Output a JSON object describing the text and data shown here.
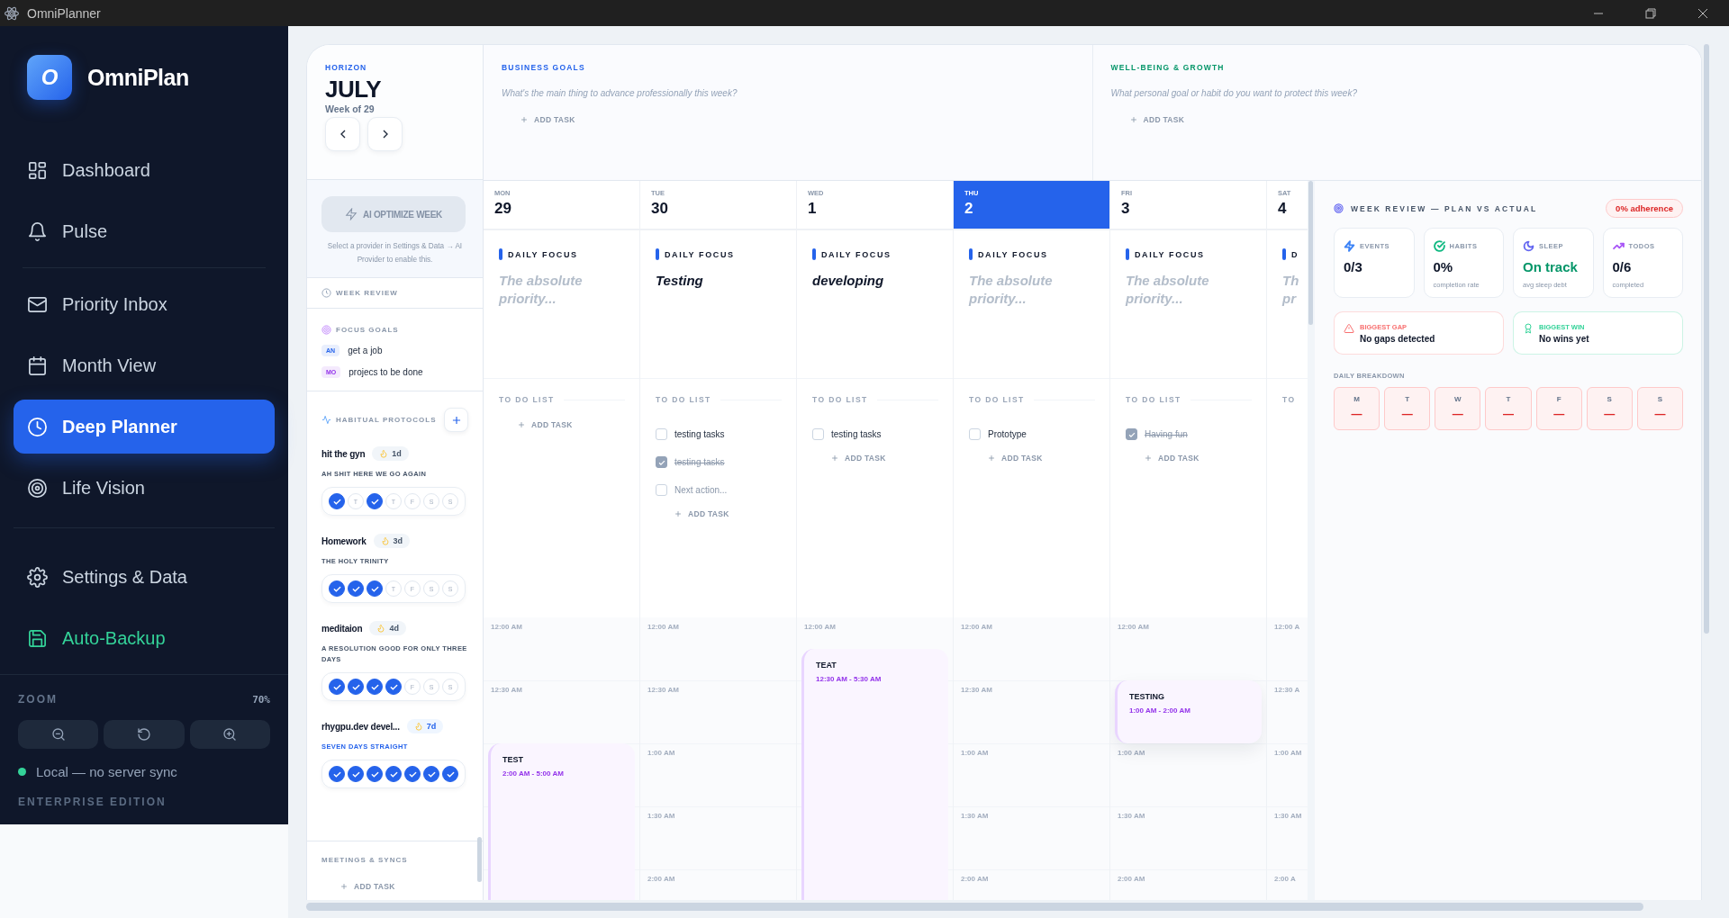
{
  "titlebar": {
    "title": "OmniPlanner"
  },
  "sidebar": {
    "brand": {
      "logo": "O",
      "name": "OmniPlan"
    },
    "groups": [
      {
        "items": [
          {
            "label": "Dashboard",
            "selected": false,
            "kind": "page"
          },
          {
            "label": "Pulse",
            "selected": false,
            "kind": "page"
          }
        ]
      },
      {
        "items": [
          {
            "label": "Priority Inbox",
            "selected": false,
            "kind": "page"
          },
          {
            "label": "Month View",
            "selected": false,
            "kind": "page"
          },
          {
            "label": "Deep Planner",
            "selected": true,
            "kind": "page"
          },
          {
            "label": "Life Vision",
            "selected": false,
            "kind": "page"
          }
        ]
      },
      {
        "items": [
          {
            "label": "Settings & Data",
            "selected": false,
            "kind": "page"
          },
          {
            "label": "Auto-Backup",
            "selected": false,
            "kind": "backup"
          }
        ]
      }
    ],
    "zoom": {
      "label": "ZOOM",
      "value": "70%"
    },
    "status": {
      "text": "Local — no server sync",
      "color": "#34d399"
    },
    "edition": "ENTERPRISE EDITION"
  },
  "horizon": {
    "label": "HORIZON",
    "month": "JULY",
    "week": "Week of 29"
  },
  "ai": {
    "button": "AI OPTIMIZE WEEK",
    "disabled": true,
    "hint": "Select a provider in Settings & Data → AI Provider to enable this."
  },
  "week_review_link": "WEEK REVIEW",
  "focus_goals": {
    "title": "FOCUS GOALS",
    "items": [
      {
        "tag": "AN",
        "text": "get a job",
        "color": "#2563eb"
      },
      {
        "tag": "MO",
        "text": "projecs to be done",
        "color": "#9333ea"
      }
    ]
  },
  "habits": {
    "title": "HABITUAL PROTOCOLS",
    "items": [
      {
        "name": "hit the gyn",
        "streak": "1d",
        "motto": "AH SHIT HERE WE GO AGAIN",
        "perfect": false,
        "days": [
          {
            "checked": true
          },
          {
            "label": "T",
            "checked": false
          },
          {
            "checked": true
          },
          {
            "label": "T",
            "checked": false
          },
          {
            "label": "F",
            "checked": false
          },
          {
            "label": "S",
            "checked": false
          },
          {
            "label": "S",
            "checked": false
          }
        ]
      },
      {
        "name": "Homework",
        "streak": "3d",
        "motto": "THE HOLY TRINITY",
        "perfect": false,
        "days": [
          {
            "checked": true
          },
          {
            "checked": true
          },
          {
            "checked": true
          },
          {
            "label": "T",
            "checked": false
          },
          {
            "label": "F",
            "checked": false
          },
          {
            "label": "S",
            "checked": false
          },
          {
            "label": "S",
            "checked": false
          }
        ]
      },
      {
        "name": "meditaion",
        "streak": "4d",
        "motto": "A RESOLUTION GOOD FOR ONLY THREE DAYS",
        "perfect": false,
        "days": [
          {
            "checked": true
          },
          {
            "checked": true
          },
          {
            "checked": true
          },
          {
            "checked": true
          },
          {
            "label": "F",
            "checked": false
          },
          {
            "label": "S",
            "checked": false
          },
          {
            "label": "S",
            "checked": false
          }
        ]
      },
      {
        "name": "rhygpu.dev devel...",
        "streak": "7d",
        "motto": "SEVEN DAYS STRAIGHT",
        "perfect": true,
        "days": [
          {
            "checked": true
          },
          {
            "checked": true
          },
          {
            "checked": true
          },
          {
            "checked": true
          },
          {
            "checked": true
          },
          {
            "checked": true
          },
          {
            "checked": true
          }
        ]
      }
    ]
  },
  "meetings": {
    "title": "MEETINGS & SYNCS",
    "add": "ADD TASK"
  },
  "goals": [
    {
      "title": "BUSINESS GOALS",
      "color": "#2563eb",
      "placeholder": "What's the main thing to advance professionally this week?",
      "add": "ADD TASK"
    },
    {
      "title": "WELL-BEING & GROWTH",
      "color": "#059669",
      "placeholder": "What personal goal or habit do you want to protect this week?",
      "add": "ADD TASK"
    }
  ],
  "days": [
    {
      "weekday": "MON",
      "date": "29",
      "selected": false,
      "focus_label": "DAILY FOCUS",
      "focus": {
        "placeholder": "The absolute priority..."
      },
      "todo_label": "TO DO LIST",
      "add": "ADD TASK",
      "times": [
        "12:00 AM",
        "12:30 AM"
      ],
      "events": [
        {
          "title": "TEST",
          "time": "2:00 AM - 5:00 AM"
        }
      ]
    },
    {
      "weekday": "TUE",
      "date": "30",
      "selected": false,
      "focus_label": "DAILY FOCUS",
      "focus": {
        "value": "Testing"
      },
      "todo_label": "TO DO LIST",
      "todos": [
        {
          "text": "testing tasks",
          "checked": false
        },
        {
          "text": "testing tasks",
          "checked": true
        }
      ],
      "todo_draft": {
        "placeholder": "Next action...",
        "checked": false
      },
      "add": "ADD TASK",
      "times": [
        "12:00 AM",
        "12:30 AM",
        "1:00 AM",
        "1:30 AM",
        "2:00 AM"
      ]
    },
    {
      "weekday": "WED",
      "date": "1",
      "selected": false,
      "focus_label": "DAILY FOCUS",
      "focus": {
        "value": "developing"
      },
      "todo_label": "TO DO LIST",
      "todos": [
        {
          "text": "testing tasks",
          "checked": false
        }
      ],
      "add": "ADD TASK",
      "times": [
        "12:00 AM"
      ],
      "events": [
        {
          "title": "TEAT",
          "time": "12:30 AM - 5:30 AM"
        }
      ]
    },
    {
      "weekday": "THU",
      "date": "2",
      "selected": true,
      "focus_label": "DAILY FOCUS",
      "focus": {
        "placeholder": "The absolute priority..."
      },
      "todo_label": "TO DO LIST",
      "todos": [
        {
          "text": "Prototype",
          "checked": false
        }
      ],
      "add": "ADD TASK",
      "times": [
        "12:00 AM",
        "12:30 AM",
        "1:00 AM",
        "1:30 AM",
        "2:00 AM"
      ]
    },
    {
      "weekday": "FRI",
      "date": "3",
      "selected": false,
      "focus_label": "DAILY FOCUS",
      "focus": {
        "placeholder": "The absolute priority..."
      },
      "todo_label": "TO DO LIST",
      "todos": [
        {
          "text": "Having fun",
          "checked": true
        }
      ],
      "add": "ADD TASK",
      "times": [
        "12:00 AM",
        "1:00 AM",
        "1:30 AM",
        "2:00 AM"
      ],
      "events": [
        {
          "title": "TESTING",
          "time": "1:00 AM - 2:00 AM"
        }
      ]
    },
    {
      "weekday": "SAT",
      "date": "4",
      "selected": false,
      "focus_label": "D",
      "focus": {
        "placeholder": "Th pr"
      },
      "todo_label": "TO",
      "times": [
        "12:00 A",
        "12:30 A",
        "1:00 AM",
        "1:30 AM",
        "2:00 A"
      ]
    }
  ],
  "review": {
    "title": "WEEK REVIEW — PLAN VS ACTUAL",
    "badge": "0% adherence",
    "stats": [
      {
        "label": "EVENTS",
        "value": "0/3",
        "color": "#3b82f6",
        "good": false
      },
      {
        "label": "HABITS",
        "value": "0%",
        "note": "completion rate",
        "color": "#10b981",
        "good": false
      },
      {
        "label": "SLEEP",
        "value": "On track",
        "note": "avg sleep debt",
        "color": "#6366f1",
        "good": true
      },
      {
        "label": "TODOS",
        "value": "0/6",
        "note": "completed",
        "color": "#a855f7",
        "good": false
      }
    ],
    "highlights": [
      {
        "label": "BIGGEST GAP",
        "text": "No gaps detected",
        "color": "#f87171"
      },
      {
        "label": "BIGGEST WIN",
        "text": "No wins yet",
        "color": "#34d399"
      }
    ],
    "breakdown": {
      "title": "DAILY BREAKDOWN",
      "days": [
        {
          "label": "M",
          "value": "—"
        },
        {
          "label": "T",
          "value": "—"
        },
        {
          "label": "W",
          "value": "—"
        },
        {
          "label": "T",
          "value": "—"
        },
        {
          "label": "F",
          "value": "—"
        },
        {
          "label": "S",
          "value": "—"
        },
        {
          "label": "S",
          "value": "—"
        }
      ]
    }
  }
}
